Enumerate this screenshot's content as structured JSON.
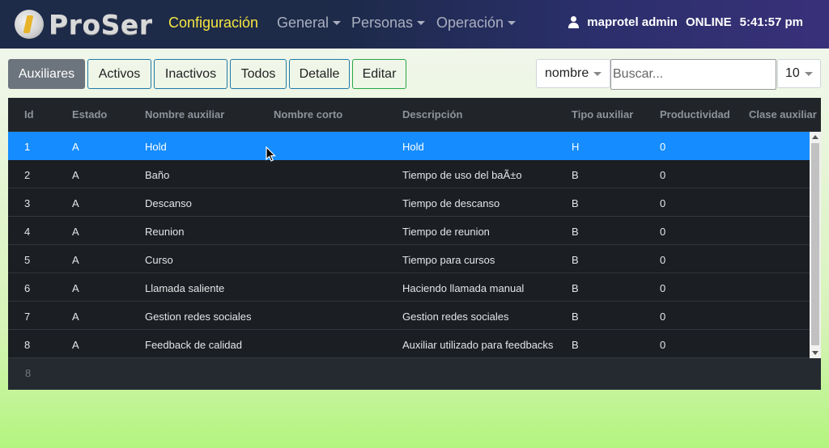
{
  "app": {
    "logo_text": "ProSer"
  },
  "nav": {
    "items": [
      {
        "label": "Configuración",
        "active": true,
        "has_menu": false
      },
      {
        "label": "General",
        "active": false,
        "has_menu": true
      },
      {
        "label": "Personas",
        "active": false,
        "has_menu": true
      },
      {
        "label": "Operación",
        "active": false,
        "has_menu": true
      }
    ],
    "user": {
      "name": "maprotel admin",
      "status": "ONLINE",
      "time": "5:41:57 pm"
    }
  },
  "toolbar": {
    "buttons": [
      {
        "label": "Auxiliares",
        "active": true
      },
      {
        "label": "Activos",
        "active": false
      },
      {
        "label": "Inactivos",
        "active": false
      },
      {
        "label": "Todos",
        "active": false
      },
      {
        "label": "Detalle",
        "active": false
      },
      {
        "label": "Editar",
        "active": false
      }
    ],
    "search_field": "nombre",
    "search_placeholder": "Buscar...",
    "page_size": "10"
  },
  "table": {
    "columns": [
      "Id",
      "Estado",
      "Nombre auxiliar",
      "Nombre corto",
      "Descripción",
      "Tipo auxiliar",
      "Productividad",
      "Clase auxiliar"
    ],
    "rows": [
      {
        "id": "1",
        "estado": "A",
        "nombre": "Hold",
        "corto": "",
        "descripcion": "Hold",
        "tipo": "H",
        "productividad": "0",
        "clase": ""
      },
      {
        "id": "2",
        "estado": "A",
        "nombre": "Baño",
        "corto": "",
        "descripcion": "Tiempo de uso del baÃ±o",
        "tipo": "B",
        "productividad": "0",
        "clase": ""
      },
      {
        "id": "3",
        "estado": "A",
        "nombre": "Descanso",
        "corto": "",
        "descripcion": "Tiempo de descanso",
        "tipo": "B",
        "productividad": "0",
        "clase": ""
      },
      {
        "id": "4",
        "estado": "A",
        "nombre": "Reunion",
        "corto": "",
        "descripcion": "Tiempo de reunion",
        "tipo": "B",
        "productividad": "0",
        "clase": ""
      },
      {
        "id": "5",
        "estado": "A",
        "nombre": "Curso",
        "corto": "",
        "descripcion": "Tiempo para cursos",
        "tipo": "B",
        "productividad": "0",
        "clase": ""
      },
      {
        "id": "6",
        "estado": "A",
        "nombre": "Llamada saliente",
        "corto": "",
        "descripcion": "Haciendo llamada manual",
        "tipo": "B",
        "productividad": "0",
        "clase": ""
      },
      {
        "id": "7",
        "estado": "A",
        "nombre": "Gestion redes sociales",
        "corto": "",
        "descripcion": "Gestion redes sociales",
        "tipo": "B",
        "productividad": "0",
        "clase": ""
      },
      {
        "id": "8",
        "estado": "A",
        "nombre": "Feedback de calidad",
        "corto": "",
        "descripcion": "Auxiliar utilizado para feedbacks",
        "tipo": "B",
        "productividad": "0",
        "clase": ""
      }
    ],
    "selected_row": 0,
    "footer_count": "8"
  },
  "colors": {
    "accent": "#158cff",
    "active_nav": "#f5e642",
    "table_bg": "#212529"
  }
}
